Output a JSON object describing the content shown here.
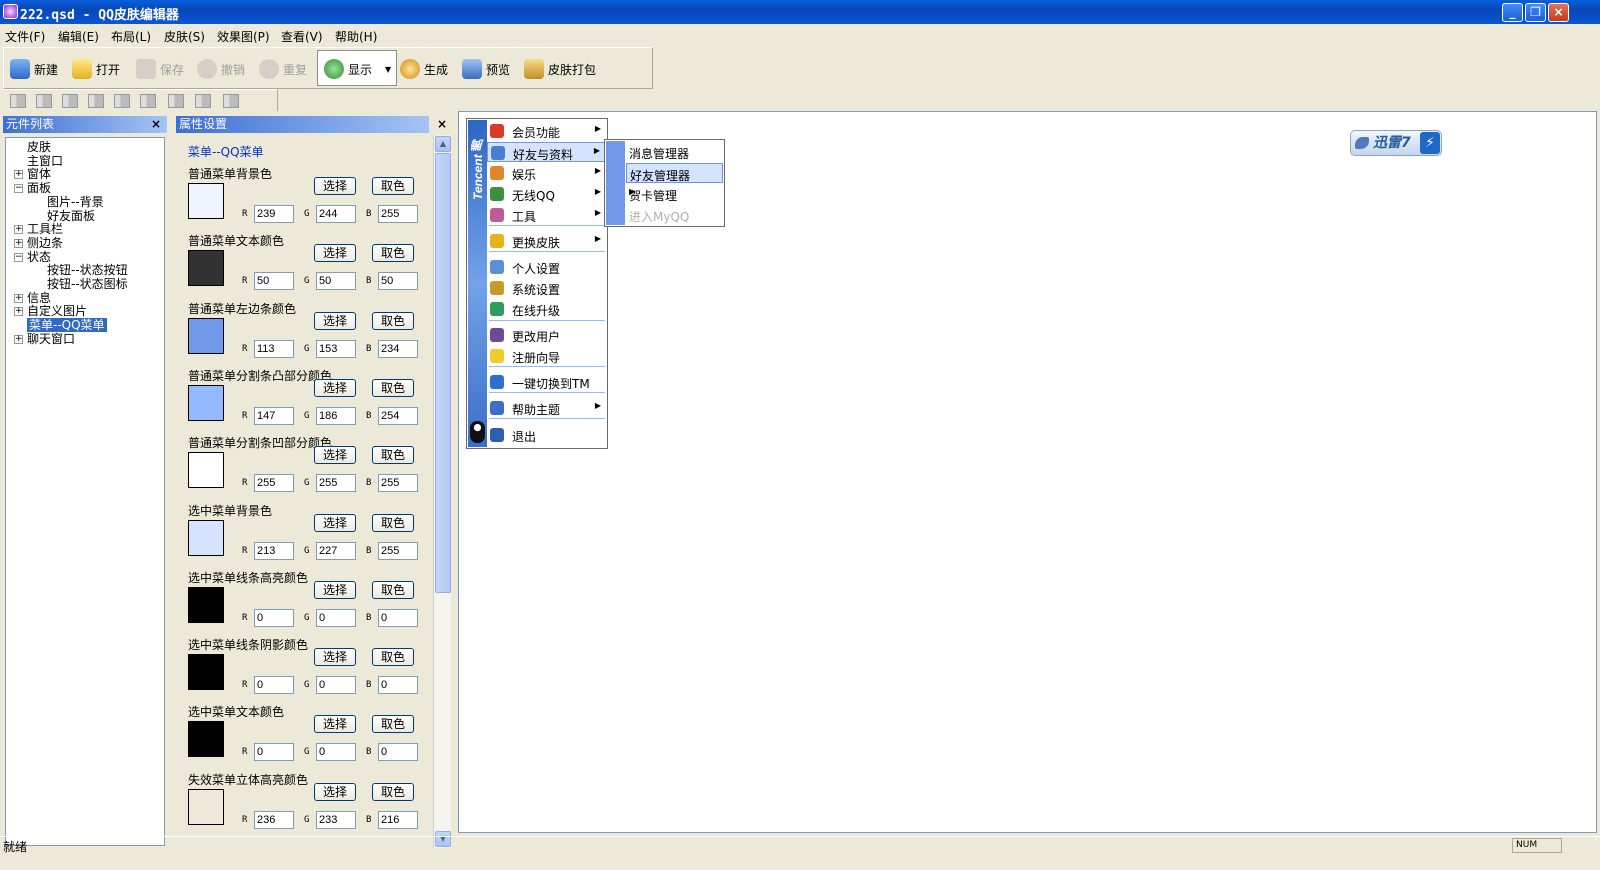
{
  "window": {
    "title": "222.qsd - QQ皮肤编辑器"
  },
  "menubar": [
    "文件(F)",
    "编辑(E)",
    "布局(L)",
    "皮肤(S)",
    "效果图(P)",
    "查看(V)",
    "帮助(H)"
  ],
  "toolbar": {
    "new": "新建",
    "open": "打开",
    "save": "保存",
    "undo": "撤销",
    "redo": "重复",
    "show": "显示",
    "generate": "生成",
    "preview": "预览",
    "pack": "皮肤打包"
  },
  "left_panel": {
    "title": "元件列表",
    "close": "×",
    "tree": [
      {
        "label": "皮肤",
        "indent": 0,
        "expander": ""
      },
      {
        "label": "主窗口",
        "indent": 0,
        "expander": ""
      },
      {
        "label": "窗体",
        "indent": 0,
        "expander": "+"
      },
      {
        "label": "面板",
        "indent": 0,
        "expander": "−"
      },
      {
        "label": "图片--背景",
        "indent": 1,
        "expander": ""
      },
      {
        "label": "好友面板",
        "indent": 1,
        "expander": ""
      },
      {
        "label": "工具栏",
        "indent": 0,
        "expander": "+"
      },
      {
        "label": "侧边条",
        "indent": 0,
        "expander": "+"
      },
      {
        "label": "状态",
        "indent": 0,
        "expander": "−"
      },
      {
        "label": "按钮--状态按钮",
        "indent": 1,
        "expander": ""
      },
      {
        "label": "按钮--状态图标",
        "indent": 1,
        "expander": ""
      },
      {
        "label": "信息",
        "indent": 0,
        "expander": "+"
      },
      {
        "label": "自定义图片",
        "indent": 0,
        "expander": "+"
      },
      {
        "label": "菜单--QQ菜单",
        "indent": 0,
        "expander": "",
        "selected": true
      },
      {
        "label": "聊天窗口",
        "indent": 0,
        "expander": "+"
      }
    ]
  },
  "prop_panel": {
    "title": "属性设置",
    "close": "×",
    "heading": "菜单--QQ菜单",
    "select_label": "选择",
    "pick_label": "取色",
    "r_label": "R",
    "g_label": "G",
    "b_label": "B",
    "items": [
      {
        "label": "普通菜单背景色",
        "r": "239",
        "g": "244",
        "b": "255",
        "color": "#eff4ff"
      },
      {
        "label": "普通菜单文本颜色",
        "r": "50",
        "g": "50",
        "b": "50",
        "color": "#323232"
      },
      {
        "label": "普通菜单左边条颜色",
        "r": "113",
        "g": "153",
        "b": "234",
        "color": "#7199ea"
      },
      {
        "label": "普通菜单分割条凸部分颜色",
        "r": "147",
        "g": "186",
        "b": "254",
        "color": "#93bafe"
      },
      {
        "label": "普通菜单分割条凹部分颜色",
        "r": "255",
        "g": "255",
        "b": "255",
        "color": "#ffffff"
      },
      {
        "label": "选中菜单背景色",
        "r": "213",
        "g": "227",
        "b": "255",
        "color": "#d5e3ff"
      },
      {
        "label": "选中菜单线条高亮颜色",
        "r": "0",
        "g": "0",
        "b": "0",
        "color": "#000000"
      },
      {
        "label": "选中菜单线条阴影颜色",
        "r": "0",
        "g": "0",
        "b": "0",
        "color": "#000000"
      },
      {
        "label": "选中菜单文本颜色",
        "r": "0",
        "g": "0",
        "b": "0",
        "color": "#000000"
      },
      {
        "label": "失效菜单立体高亮颜色",
        "r": "236",
        "g": "233",
        "b": "216",
        "color": "#ece9d8"
      }
    ]
  },
  "qq_menu": {
    "brand": "Tencent 腾讯",
    "items": [
      {
        "label": "会员功能",
        "icon": "member-icon",
        "arrow": true
      },
      {
        "label": "好友与资料",
        "icon": "contacts-icon",
        "arrow": true,
        "highlighted": true
      },
      {
        "label": "娱乐",
        "icon": "entertainment-icon",
        "arrow": true
      },
      {
        "label": "无线QQ",
        "icon": "mobile-icon",
        "arrow": true
      },
      {
        "label": "工具",
        "icon": "tools-icon",
        "arrow": true
      },
      {
        "label": "更换皮肤",
        "icon": "shirt-icon",
        "arrow": true
      },
      {
        "label": "个人设置",
        "icon": "profile-icon",
        "arrow": false
      },
      {
        "label": "系统设置",
        "icon": "key-icon",
        "arrow": false
      },
      {
        "label": "在线升级",
        "icon": "globe-icon",
        "arrow": false
      },
      {
        "label": "更改用户",
        "icon": "user-switch-icon",
        "arrow": false
      },
      {
        "label": "注册向导",
        "icon": "bulb-icon",
        "arrow": false
      },
      {
        "label": "一键切换到TM",
        "icon": "tm-icon",
        "arrow": false
      },
      {
        "label": "帮助主题",
        "icon": "help-icon",
        "arrow": true
      },
      {
        "label": "退出",
        "icon": "exit-icon",
        "arrow": false
      }
    ],
    "submenu": [
      {
        "label": "消息管理器",
        "state": "normal"
      },
      {
        "label": "好友管理器",
        "state": "hover"
      },
      {
        "label": "贺卡管理",
        "state": "normal",
        "arrow": true
      },
      {
        "label": "进入MyQQ",
        "state": "disabled"
      }
    ]
  },
  "xunlei": {
    "text": "迅雷7",
    "bolt": "⚡"
  },
  "status": {
    "text": "就绪",
    "num": "NUM"
  }
}
